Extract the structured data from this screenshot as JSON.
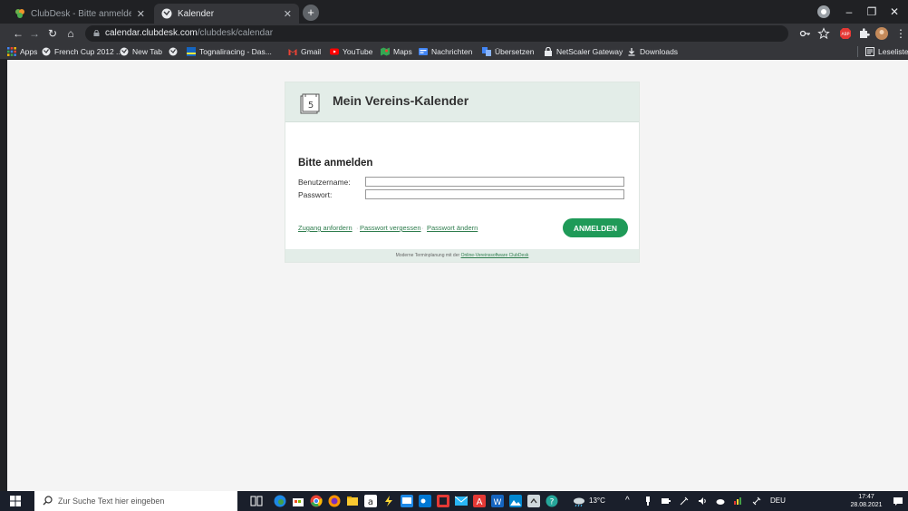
{
  "browser": {
    "tabs": [
      {
        "title": "ClubDesk - Bitte anmelden",
        "active": false
      },
      {
        "title": "Kalender",
        "active": true
      }
    ],
    "address": {
      "host": "calendar.clubdesk.com",
      "path": "/clubdesk/calendar"
    },
    "bookmarks": [
      {
        "label": "Apps",
        "icon": "apps-grid-icon"
      },
      {
        "label": "French Cup 2012 ...",
        "icon": "globe-icon"
      },
      {
        "label": "New Tab",
        "icon": "globe-icon"
      },
      {
        "label": "Tognaliracing - Das...",
        "icon": "tognali-icon"
      },
      {
        "label": "Gmail",
        "icon": "gmail-icon"
      },
      {
        "label": "YouTube",
        "icon": "youtube-icon"
      },
      {
        "label": "Maps",
        "icon": "maps-icon"
      },
      {
        "label": "Nachrichten",
        "icon": "news-icon"
      },
      {
        "label": "Übersetzen",
        "icon": "translate-icon"
      },
      {
        "label": "NetScaler Gateway",
        "icon": "gateway-icon"
      },
      {
        "label": "Downloads",
        "icon": "download-icon"
      }
    ],
    "reading_list": "Leseliste"
  },
  "calendar": {
    "icon_number": "5",
    "title": "Mein Vereins-Kalender",
    "login_heading": "Bitte anmelden",
    "username_label": "Benutzername:",
    "password_label": "Passwort:",
    "username_value": "",
    "password_value": "",
    "links": {
      "request": "Zugang anfordern",
      "forgot": "Passwort vergessen",
      "change": "Passwort ändern"
    },
    "login_button": "ANMELDEN",
    "footer_text": "Moderne Terminplanung mit der",
    "footer_link": "Online-Vereinssoftware ClubDesk"
  },
  "taskbar": {
    "search_placeholder": "Zur Suche Text hier eingeben",
    "weather": "13°C",
    "language": "DEU",
    "time": "17:47",
    "date": "28.08.2021"
  },
  "colors": {
    "accent_green": "#1f9a58",
    "header_mint": "#e3ede8",
    "link_green": "#2f7d4e"
  }
}
